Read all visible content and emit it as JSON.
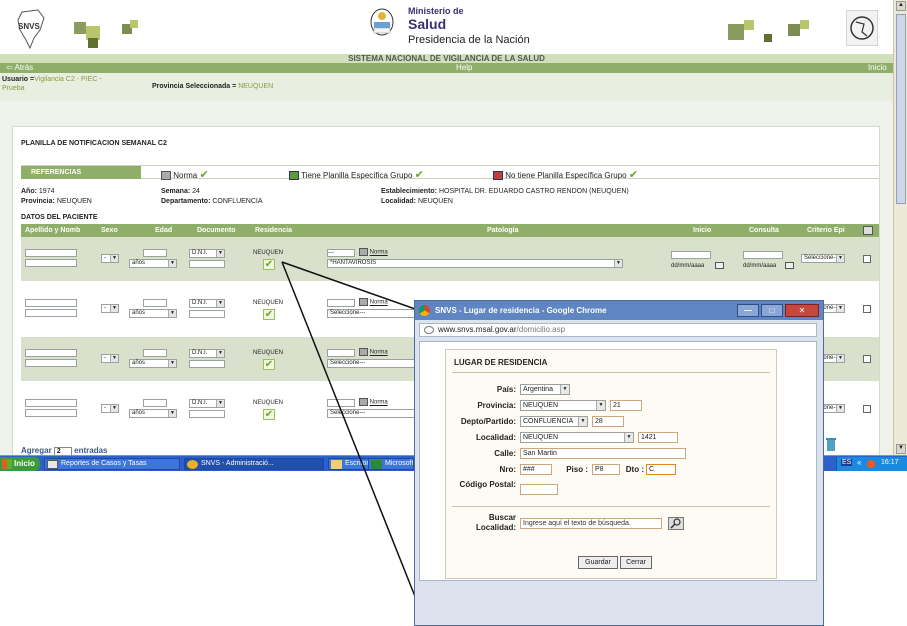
{
  "header": {
    "brand_logo": "SNVS",
    "ministry_line1": "Ministerio de",
    "ministry_line2": "Salud",
    "ministry_line3": "Presidencia de la Nación",
    "system_title": "SISTEMA NACIONAL DE VIGILANCIA DE LA SALUD"
  },
  "nav": {
    "back": "Atrás",
    "help": "Help",
    "home": "Inicio"
  },
  "user_bar": {
    "user_label": "Usuario =",
    "user_value": "Vigilancia C2 - PIEC - Prueba",
    "province_label": "Provincia Seleccionada =",
    "province_value": "NEUQUEN"
  },
  "form": {
    "title": "PLANILLA DE NOTIFICACION SEMANAL C2",
    "refs_label": "REFERENCIAS",
    "ref_norma": "Norma",
    "ref_tiene": "Tiene Planilla Específica Grupo",
    "ref_no_tiene": "No tiene Planilla Específica Grupo",
    "info": {
      "anio_label": "Año:",
      "anio_value": "1974",
      "semana_label": "Semana:",
      "semana_value": "24",
      "estab_label": "Establecimiento:",
      "estab_value": "HOSPITAL DR. EDUARDO CASTRO RENDON (NEUQUEN)",
      "prov_label": "Provincia:",
      "prov_value": "NEUQUEN",
      "depto_label": "Departamento:",
      "depto_value": "CONFLUENCIA",
      "loc_label": "Localidad:",
      "loc_value": "NEUQUEN"
    },
    "section_title": "DATOS DEL PACIENTE",
    "columns": [
      "Apellido y Nomb",
      "Sexo",
      "Edad",
      "Documento",
      "Residencia",
      "Patología",
      "Inicio",
      "Consulta",
      "Criterio Epi"
    ],
    "rows": [
      {
        "sexo": "-",
        "edad_unit": "años",
        "doc_type": "D.N.I.",
        "residencia": "NEUQUEN",
        "pat_code": "---",
        "pat_norma": "Norma",
        "pat_value": "*HANTAVIROSIS",
        "inicio_ph": "dd/mm/aaaa",
        "consulta_ph": "dd/mm/aaaa",
        "criterio": "Seleccione---"
      },
      {
        "sexo": "-",
        "edad_unit": "años",
        "doc_type": "D.N.I.",
        "residencia": "NEUQUEN",
        "pat_norma": "Norma",
        "pat_value": "Seleccione---",
        "criterio": "Seleccione---"
      },
      {
        "sexo": "-",
        "edad_unit": "años",
        "doc_type": "D.N.I.",
        "residencia": "NEUQUEN",
        "pat_norma": "Norma",
        "pat_value": "Seleccione---",
        "criterio": "Seleccione---"
      },
      {
        "sexo": "-",
        "edad_unit": "años",
        "doc_type": "D.N.I.",
        "residencia": "NEUQUEN",
        "pat_norma": "Norma",
        "pat_value": "Seleccione---",
        "criterio": "Seleccione---"
      }
    ],
    "agregar_label": "Agregar",
    "agregar_value": "2",
    "entradas_label": "entradas"
  },
  "taskbar": {
    "start": "Inicio",
    "tasks": [
      "Reportes de Casos y Tasas",
      "SNVS - Administració...",
      "Escritorio",
      "Microsoft"
    ],
    "lang": "ES",
    "clock": "16:17"
  },
  "popup": {
    "window_title": "SNVS - Lugar de residencia - Google Chrome",
    "url_host": "www.snvs.msal.gov.ar",
    "url_path": "/domicilio.asp",
    "heading": "LUGAR DE RESIDENCIA",
    "pais_label": "País:",
    "pais_value": "Argentina",
    "provincia_label": "Provincia:",
    "provincia_value": "NEUQUEN",
    "provincia_code": "21",
    "depto_label": "Depto/Partido:",
    "depto_value": "CONFLUENCIA",
    "depto_code": "28",
    "localidad_label": "Localidad:",
    "localidad_value": "NEUQUEN",
    "localidad_code": "1421",
    "calle_label": "Calle:",
    "calle_value": "San Martin",
    "nro_label": "Nro:",
    "nro_value": "###",
    "piso_label": "Piso :",
    "piso_value": "P8",
    "dto_label": "Dto :",
    "dto_value": "C",
    "cp_label": "Código Postal:",
    "buscar_label": "Buscar Localidad:",
    "buscar_placeholder": "Ingrese aquí el texto de búsqueda.",
    "guardar": "Guardar",
    "cerrar": "Cerrar"
  },
  "colors": {
    "accent_green": "#8fae6a",
    "band_green": "#d9e1cd",
    "popup_blue": "#5f85c2",
    "taskbar_blue": "#2d60c8"
  }
}
